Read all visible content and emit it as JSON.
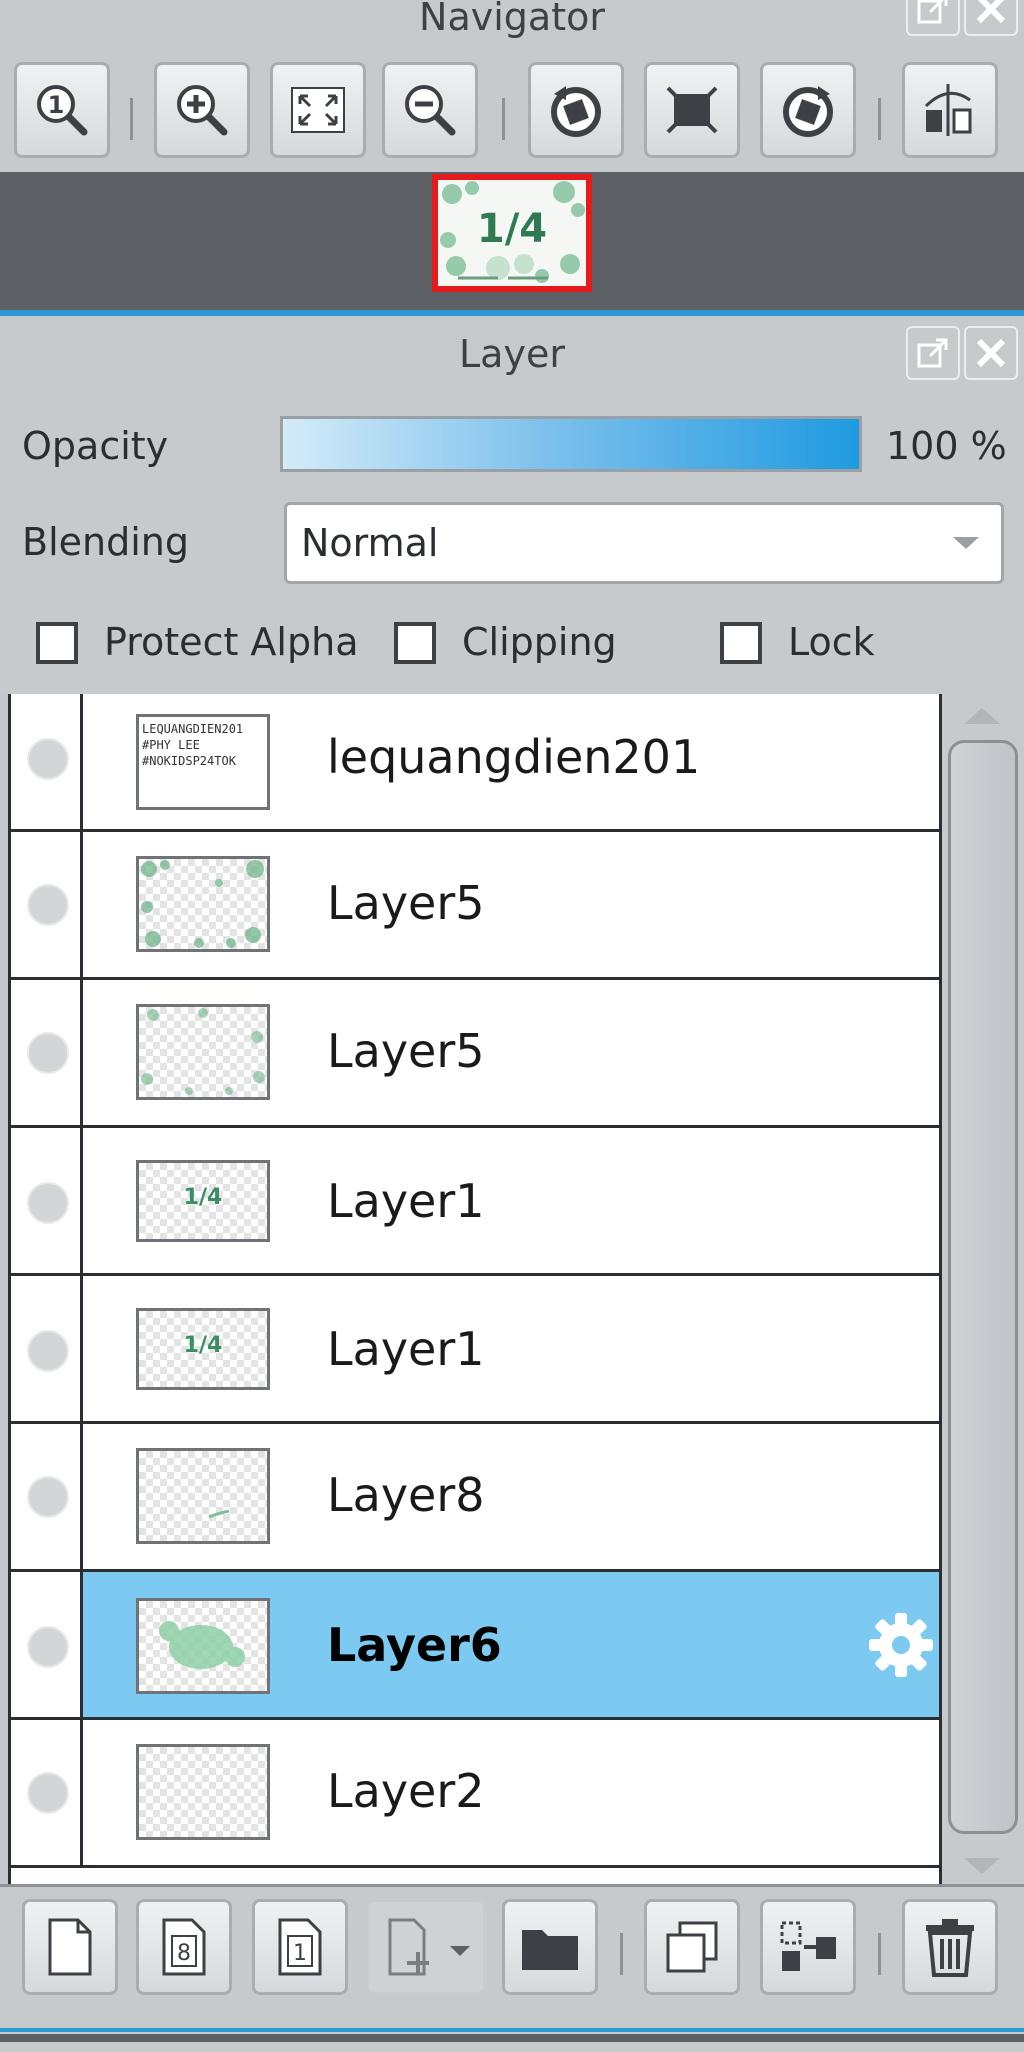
{
  "navigator": {
    "title": "Navigator",
    "toolbar": [
      {
        "icon": "zoom-actual-size-icon",
        "name": "zoom-actual-size-button"
      },
      {
        "icon": "zoom-in-icon",
        "name": "zoom-in-button"
      },
      {
        "icon": "fit-to-window-icon",
        "name": "fit-window-button"
      },
      {
        "icon": "zoom-out-icon",
        "name": "zoom-out-button"
      },
      {
        "icon": "rotate-left-icon",
        "name": "rotate-left-button"
      },
      {
        "icon": "reset-view-icon",
        "name": "reset-view-button"
      },
      {
        "icon": "rotate-right-icon",
        "name": "rotate-right-button"
      },
      {
        "icon": "flip-horizontal-icon",
        "name": "flip-horizontal-button"
      }
    ],
    "preview_text": "1/4"
  },
  "layer_panel": {
    "title": "Layer",
    "opacity_label": "Opacity",
    "opacity_value": "100 %",
    "opacity_fraction": 1.0,
    "blending_label": "Blending",
    "blending_value": "Normal",
    "checkboxes": [
      {
        "label": "Protect Alpha",
        "checked": false
      },
      {
        "label": "Clipping",
        "checked": false
      },
      {
        "label": "Lock",
        "checked": false
      }
    ],
    "layers": [
      {
        "name": "lequangdien201",
        "selected": false,
        "thumb": "text"
      },
      {
        "name": "Layer5",
        "selected": false,
        "thumb": "frame"
      },
      {
        "name": "Layer5",
        "selected": false,
        "thumb": "frame2"
      },
      {
        "name": "Layer1",
        "selected": false,
        "thumb": "fraction"
      },
      {
        "name": "Layer1",
        "selected": false,
        "thumb": "fraction"
      },
      {
        "name": "Layer8",
        "selected": false,
        "thumb": "small"
      },
      {
        "name": "Layer6",
        "selected": true,
        "thumb": "blob"
      },
      {
        "name": "Layer2",
        "selected": false,
        "thumb": "empty"
      }
    ],
    "thumb_text": [
      "LEQUANGDIEN201",
      "#PHY LEE",
      "#NOKIDSP24TOK"
    ],
    "thumb_fraction": "1/4",
    "bottom_toolbar": [
      {
        "icon": "new-layer-icon",
        "name": "new-layer-button"
      },
      {
        "icon": "new-8bit-layer-icon",
        "name": "new-8bit-layer-button",
        "text": "8"
      },
      {
        "icon": "new-1bit-layer-icon",
        "name": "new-1bit-layer-button",
        "text": "1"
      },
      {
        "icon": "add-layer-menu-icon",
        "name": "add-layer-menu-button"
      },
      {
        "icon": "folder-icon",
        "name": "new-folder-button"
      },
      {
        "icon": "duplicate-layer-icon",
        "name": "duplicate-layer-button"
      },
      {
        "icon": "merge-down-icon",
        "name": "merge-down-button"
      },
      {
        "icon": "trash-icon",
        "name": "delete-layer-button"
      }
    ],
    "colors": {
      "selection": "#7ccaf2",
      "accent": "#2b99d6",
      "preview_border": "#e51a1a"
    }
  }
}
